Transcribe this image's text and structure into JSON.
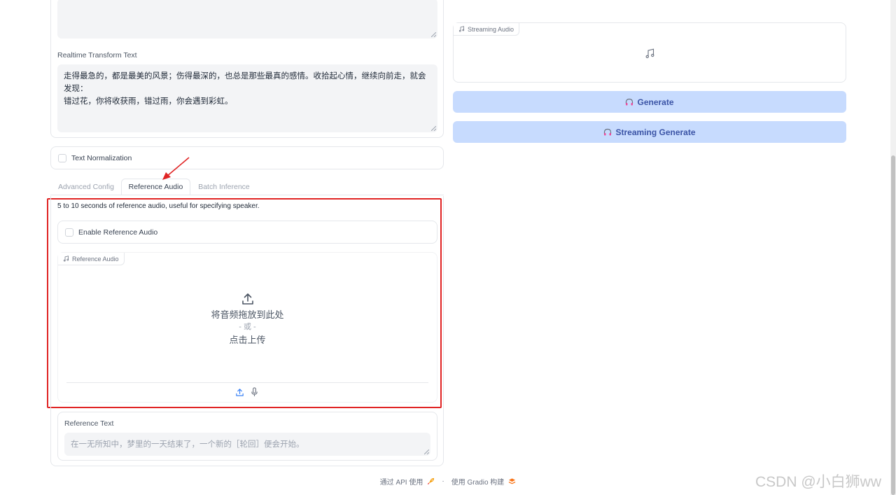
{
  "left": {
    "realtime_transform": {
      "label": "Realtime Transform Text",
      "line1": "走得最急的，都是最美的风景；伤得最深的，也总是那些最真的感情。收拾起心情，继续向前走，就会发现：",
      "line2": "错过花，你将收获雨，错过雨，你会遇到彩虹。"
    },
    "text_normalization": {
      "label": "Text Normalization",
      "checked": false
    },
    "tabs": [
      {
        "label": "Advanced Config",
        "active": false
      },
      {
        "label": "Reference Audio",
        "active": true
      },
      {
        "label": "Batch Inference",
        "active": false
      }
    ],
    "reference_audio": {
      "description": "5 to 10 seconds of reference audio, useful for specifying speaker.",
      "enable_label": "Enable Reference Audio",
      "audio_tag": "Reference Audio",
      "drop_text": "将音频拖放到此处",
      "or_text": "- 或 -",
      "click_text": "点击上传"
    },
    "reference_text": {
      "label": "Reference Text",
      "placeholder": "在一无所知中，梦里的一天结束了，一个新的［轮回］便会开始。"
    }
  },
  "right": {
    "streaming_audio_tag": "Streaming Audio",
    "generate_label": "Generate",
    "streaming_generate_label": "Streaming Generate"
  },
  "footer": {
    "api_text": "通过 API 使用",
    "separator": "·",
    "built_text": "使用 Gradio 构建"
  },
  "watermark": "CSDN @小白狮ww",
  "colors": {
    "button_bg": "#c7dbfe",
    "button_text": "#3b54a6",
    "highlight_border": "#e02424",
    "input_bg": "#f3f4f6"
  },
  "icons": [
    "music-note-icon",
    "headphones-icon",
    "upload-icon",
    "microphone-icon",
    "rocket-icon",
    "gradio-logo-icon",
    "arrow-annotation-icon"
  ]
}
